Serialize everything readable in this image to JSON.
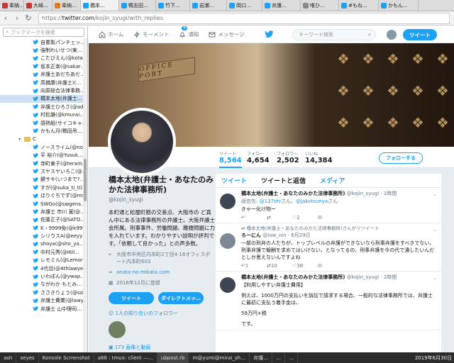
{
  "browser": {
    "tabs": [
      {
        "label": "奉納…",
        "color": "#c33"
      },
      {
        "label": "大崎…",
        "color": "#c33"
      },
      {
        "label": "奉納…",
        "color": "#e07a20"
      },
      {
        "label": "橋本…",
        "color": "#1da1f2",
        "active": true
      },
      {
        "label": "鴨志田…",
        "color": "#1da1f2"
      },
      {
        "label": "竹下…",
        "color": "#1da1f2"
      },
      {
        "label": "岩瀬…",
        "color": "#1da1f2"
      },
      {
        "label": "岡口…",
        "color": "#1da1f2"
      },
      {
        "label": "弁護…",
        "color": "#1da1f2"
      },
      {
        "label": "唯ひ…",
        "color": "#888"
      },
      {
        "label": "#もね…",
        "color": "#1da1f2"
      },
      {
        "label": "かもん…",
        "color": "#1da1f2"
      }
    ],
    "url_scheme": "https://",
    "url_host": "twitter.com",
    "url_path": "/kojin_syugi/with_replies"
  },
  "sidebar": {
    "search_placeholder": "ブックマークを検索",
    "items": [
      {
        "label": "自重製パンチェッ…",
        "type": "bird"
      },
      {
        "label": "強制わいせつ(東…",
        "type": "bird"
      },
      {
        "label": "こたびえん(@kota…",
        "type": "bird"
      },
      {
        "label": "坂本正幸(@sakar…",
        "type": "bird"
      },
      {
        "label": "弁護士あだちあだ…",
        "type": "bird"
      },
      {
        "label": "高橋康(弁護士)(…",
        "type": "bird"
      },
      {
        "label": "向原総合法律事務…",
        "type": "bird"
      },
      {
        "label": "橋本太地(弁護士…",
        "type": "bird",
        "selected": true
      },
      {
        "label": "弁護士ひろさ(@adv…",
        "type": "bird"
      },
      {
        "label": "村松謙(@kmurai…",
        "type": "bird"
      },
      {
        "label": "感熱紙(サイコキャ…",
        "type": "bird"
      },
      {
        "label": "かもん月(鴨田吊…",
        "type": "bird"
      },
      {
        "label": "C",
        "type": "folder"
      },
      {
        "label": "ノースライム(@no…",
        "type": "bird"
      },
      {
        "label": "平 裕介(@Yusuk…",
        "type": "bird"
      },
      {
        "label": "寺町東子(@teram…",
        "type": "bird"
      },
      {
        "label": "スヤスヤいろこ(@…",
        "type": "bird"
      },
      {
        "label": "鍵サキ(いつまで?…",
        "type": "bird"
      },
      {
        "label": "すが(@suka_ti_ti)…",
        "type": "bird"
      },
      {
        "label": "ほりぐちでず(@ms…",
        "type": "bird"
      },
      {
        "label": "SWGo(@swgens…",
        "type": "bird"
      },
      {
        "label": "弁護士 市川 寛(@…",
        "type": "bird"
      },
      {
        "label": "佐藤正子(@SATO…",
        "type": "bird"
      },
      {
        "label": "K・9999免(@k999…",
        "type": "bird"
      },
      {
        "label": "シリウスA(@eeyyi…",
        "type": "bird"
      },
      {
        "label": "shoya(@sho_ya…",
        "type": "bird"
      },
      {
        "label": "中村元秀(@I6il…",
        "type": "bird"
      },
      {
        "label": "レモミル(@Lemor…",
        "type": "bird"
      },
      {
        "label": "4代目(@4thlawye…",
        "type": "bird"
      },
      {
        "label": "いわぽん(@ywap…",
        "type": "bird"
      },
      {
        "label": "ながわか もとみ…",
        "type": "bird"
      },
      {
        "label": "ささきりょう(@ssk_…",
        "type": "bird"
      },
      {
        "label": "弁護士費業(@lawy…",
        "type": "bird"
      },
      {
        "label": "弁護士 山中理司…",
        "type": "bird"
      }
    ]
  },
  "twitter": {
    "nav": {
      "home": "ホーム",
      "moments": "モーメント",
      "notifications": "通知",
      "notif_count": "4",
      "messages": "メッセージ"
    },
    "search_placeholder": "キーワード検索",
    "tweet_button": "ツイート",
    "banner_sign": "OFFICE PORT",
    "stats": [
      {
        "label": "ツイート",
        "value": "8,564",
        "active": true
      },
      {
        "label": "フォロー",
        "value": "4,654"
      },
      {
        "label": "フォロワー",
        "value": "2,502"
      },
      {
        "label": "いいね",
        "value": "14,384"
      }
    ],
    "follow_button": "フォローする",
    "profile": {
      "name": "橋本太地(弁護士・あなたのみかた法律事務所)",
      "handle": "@kojin_syugi",
      "bio": "本町通と松屋町筋の交差点、大阪市の ど真ん中にある法律事務所の弁護士。大阪弁護士会所属。刑事事件、労働問題、離婚問題に力を入れています。わかりやすい説明が評判です。「依頼して良かった」との声多数。",
      "location": "大阪市中央区内本町2丁目4-16オフィスポート内本町603",
      "website": "anata-no-mikata.com",
      "joined": "2016年12月に登録",
      "tweet_btn": "ツイート",
      "dm_btn": "ダイレクトメッ…",
      "mutual": "1人の知り合いのフォロワー",
      "media": "173 画像と動画"
    },
    "timeline": {
      "tabs": [
        "ツイート",
        "ツイートと返信",
        "メディア"
      ],
      "tweets": [
        {
          "name": "橋本太地(弁護士・あなたのみかた法律事務所)",
          "meta": "@kojin_syugi · 1時間",
          "reply_to": "返信先: ",
          "mention1": "@137shi",
          "mid": "さん、",
          "mention2": "@Jakotsunya",
          "end": "さん",
          "text": "きゃー化け物ー",
          "replies": "",
          "rts": "",
          "likes": "2",
          "rt_note": ""
        },
        {
          "name": "ろーにん",
          "meta": "@law_nin · 6月29日",
          "rt_note": "橋本太地(弁護士・あなたのみかた法律事務所)さんがリツイート",
          "text": "一部の刑弁の人たちが、トップレベルの弁護ができないなら刑事弁護をすべきでない、刑事弁護で報酬を求めてはいけない、となってるの、刑事弁護を今の代で潰したいんだとしか思えないんですよね",
          "replies": "1",
          "rts": "10",
          "likes": "38"
        },
        {
          "name": "橋本太地(弁護士・あなたのみかた法律事務所)",
          "meta": "@kojin_syugi · 2時間",
          "text": "【利用しやすい弁護士費用】",
          "text2": "例えば、1000万円の支払いを訴訟で請求する場合、一般的な法律事務所では、弁護士に最初に支払う着手金は、",
          "text3": "59万円+税",
          "text4": "です。"
        }
      ]
    }
  },
  "taskbar": {
    "items": [
      "ash",
      "xeyes",
      "Konsole Scrrenshot",
      "a66 : tmux: client —…",
      "ubpost.rb",
      "m@yumi@mirai_sh…",
      "弁護…",
      "…",
      "…"
    ],
    "clock": "2019年6月30日"
  }
}
